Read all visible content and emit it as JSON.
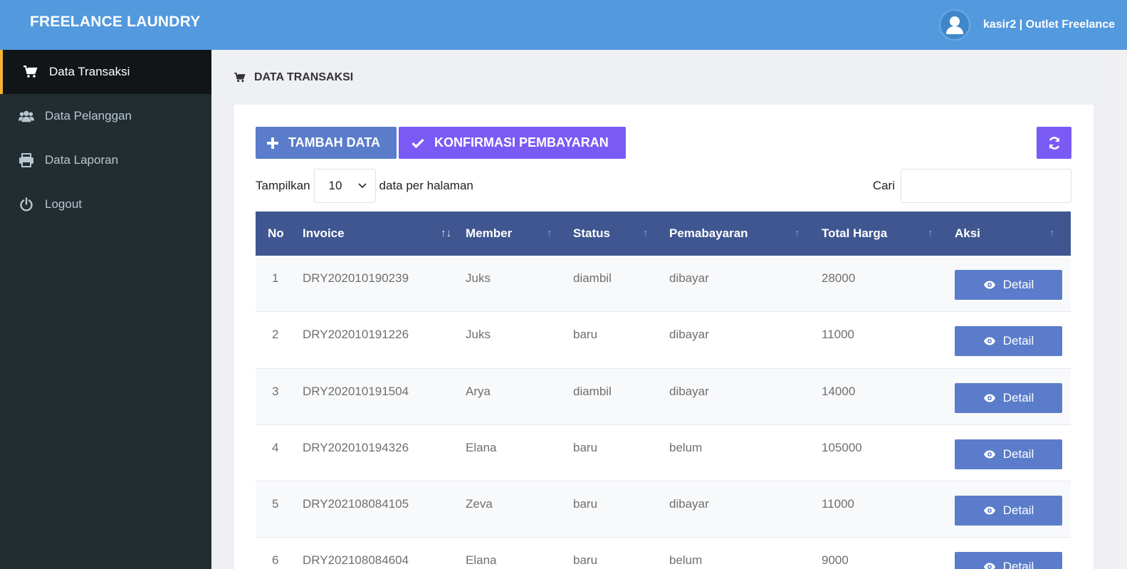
{
  "brand": "FREELANCE LAUNDRY",
  "user": {
    "label": "kasir2 | Outlet Freelance"
  },
  "sidebar": {
    "items": [
      {
        "label": "Data Transaksi",
        "icon": "cart-icon",
        "active": true
      },
      {
        "label": "Data Pelanggan",
        "icon": "users-icon",
        "active": false
      },
      {
        "label": "Data Laporan",
        "icon": "printer-icon",
        "active": false
      },
      {
        "label": "Logout",
        "icon": "power-icon",
        "active": false
      }
    ]
  },
  "page": {
    "title": "DATA TRANSAKSI"
  },
  "toolbar": {
    "add_label": "TAMBAH DATA",
    "confirm_label": "KONFIRMASI PEMBAYARAN"
  },
  "length": {
    "prefix": "Tampilkan",
    "value": "10",
    "suffix": "data per halaman"
  },
  "search": {
    "label": "Cari",
    "value": "",
    "placeholder": ""
  },
  "table": {
    "columns": [
      "No",
      "Invoice",
      "Member",
      "Status",
      "Pemabayaran",
      "Total Harga",
      "Aksi"
    ],
    "action_label": "Detail",
    "rows": [
      {
        "no": "1",
        "invoice": "DRY202010190239",
        "member": "Juks",
        "status": "diambil",
        "payment": "dibayar",
        "total": "28000"
      },
      {
        "no": "2",
        "invoice": "DRY202010191226",
        "member": "Juks",
        "status": "baru",
        "payment": "dibayar",
        "total": "11000"
      },
      {
        "no": "3",
        "invoice": "DRY202010191504",
        "member": "Arya",
        "status": "diambil",
        "payment": "dibayar",
        "total": "14000"
      },
      {
        "no": "4",
        "invoice": "DRY202010194326",
        "member": "Elana",
        "status": "baru",
        "payment": "belum",
        "total": "105000"
      },
      {
        "no": "5",
        "invoice": "DRY202108084105",
        "member": "Zeva",
        "status": "baru",
        "payment": "dibayar",
        "total": "11000"
      },
      {
        "no": "6",
        "invoice": "DRY202108084604",
        "member": "Elana",
        "status": "baru",
        "payment": "belum",
        "total": "9000"
      }
    ]
  },
  "colors": {
    "topbar": "#5399de",
    "sidebar": "#222d32",
    "accent": "#f5b335",
    "primary": "#5a7cca",
    "purple": "#7a5af5",
    "thead": "#3f5691"
  }
}
